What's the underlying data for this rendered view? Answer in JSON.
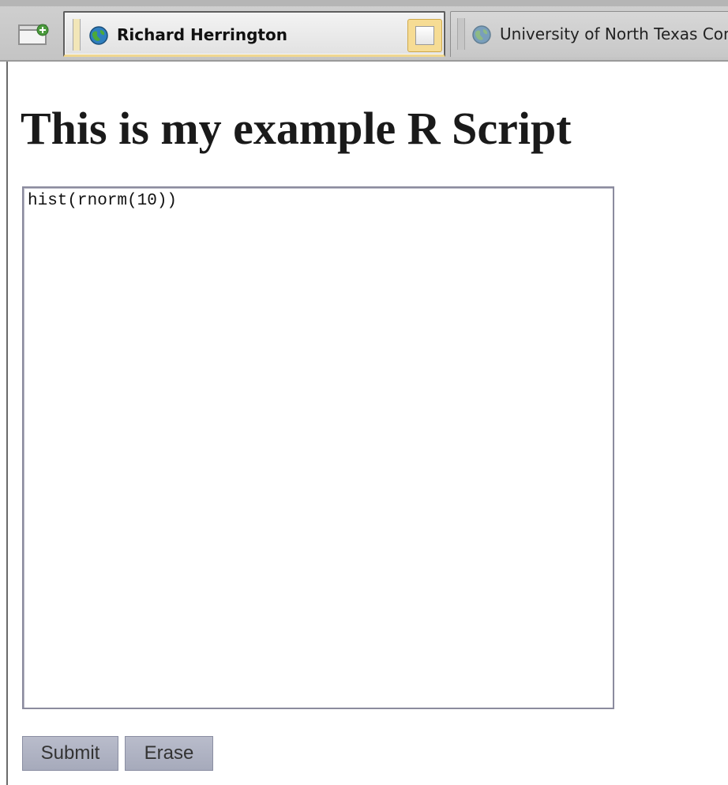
{
  "browser": {
    "new_tab_icon": "new-tab-icon",
    "tabs": [
      {
        "title": "Richard Herrington",
        "icon": "globe-icon",
        "active": true
      },
      {
        "title": "University of North Texas Com",
        "icon": "globe-icon",
        "active": false
      }
    ],
    "accent_active_tab": "#f6dc94"
  },
  "page": {
    "heading": "This is my example R Script",
    "script": {
      "value": "hist(rnorm(10))"
    },
    "buttons": {
      "submit": "Submit",
      "erase": "Erase"
    }
  }
}
